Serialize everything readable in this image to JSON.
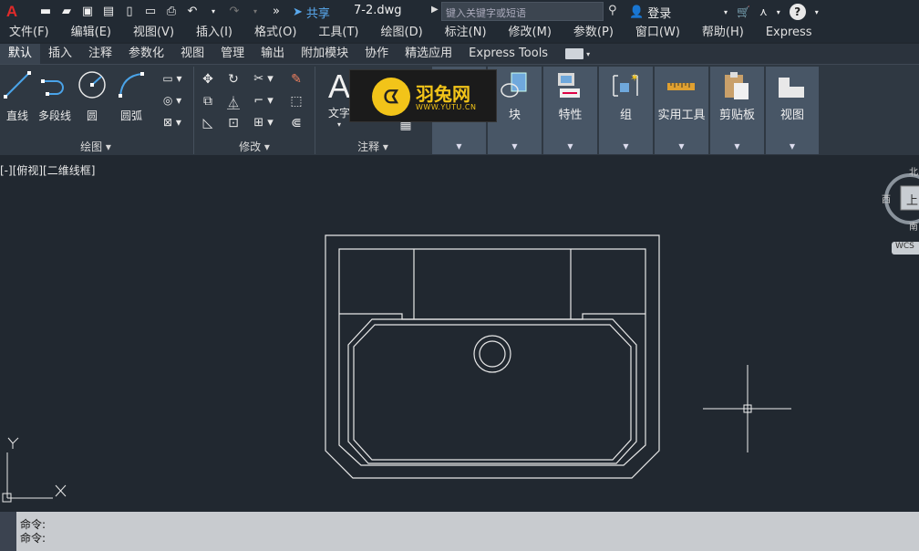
{
  "app": {
    "logo_letter": "A",
    "file_title": "7-2.dwg"
  },
  "quick_access": {
    "share_label": "共享"
  },
  "search": {
    "placeholder": "键入关键字或短语"
  },
  "user": {
    "login_label": "登录"
  },
  "menu": [
    "文件(F)",
    "编辑(E)",
    "视图(V)",
    "插入(I)",
    "格式(O)",
    "工具(T)",
    "绘图(D)",
    "标注(N)",
    "修改(M)",
    "参数(P)",
    "窗口(W)",
    "帮助(H)",
    "Express"
  ],
  "ribbon_tabs": [
    "默认",
    "插入",
    "注释",
    "参数化",
    "视图",
    "管理",
    "输出",
    "附加模块",
    "协作",
    "精选应用",
    "Express Tools"
  ],
  "draw_panel": {
    "tools": [
      "直线",
      "多段线",
      "圆",
      "圆弧"
    ],
    "label": "绘图"
  },
  "modify_panel": {
    "label": "修改"
  },
  "annotation_panel": {
    "text_tool": "文字",
    "label": "注释"
  },
  "groups": [
    "块",
    "特性",
    "组",
    "实用工具",
    "剪贴板",
    "视图"
  ],
  "watermark": {
    "name": "羽兔网",
    "url": "WWW.YUTU.CN"
  },
  "viewport": {
    "label": "[-][俯视][二维线框]"
  },
  "viewcube": {
    "north": "北",
    "west": "西",
    "south": "南",
    "face": "上",
    "wcs": "WCS"
  },
  "ucs": {
    "x": "X",
    "y": "Y"
  },
  "command": {
    "line1": "命令:",
    "line2": "命令:"
  },
  "colors": {
    "background": "#212830",
    "accent": "#5aaaf0",
    "logo": "#e02a2a",
    "watermark": "#f2c419"
  }
}
